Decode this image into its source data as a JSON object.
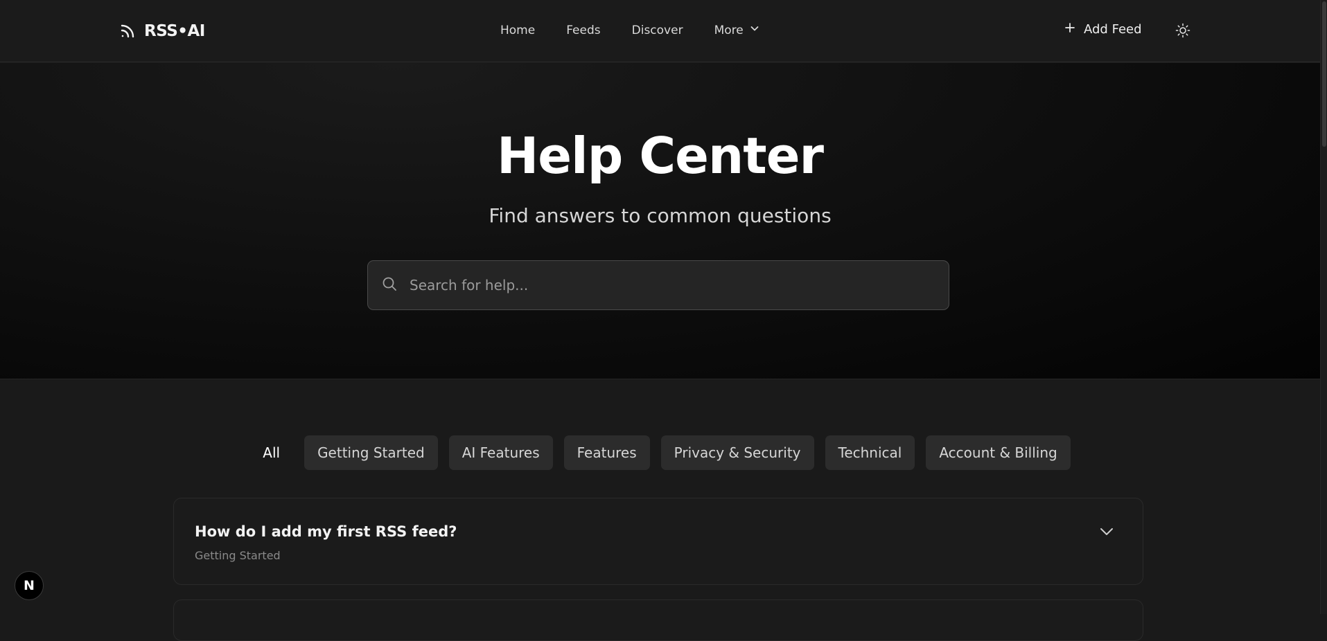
{
  "header": {
    "brand": "RSS•AI",
    "nav": [
      {
        "label": "Home"
      },
      {
        "label": "Feeds"
      },
      {
        "label": "Discover"
      },
      {
        "label": "More"
      }
    ],
    "add_feed_label": "Add Feed"
  },
  "hero": {
    "title": "Help Center",
    "subtitle": "Find answers to common questions",
    "search_placeholder": "Search for help..."
  },
  "filters": [
    {
      "label": "All",
      "active": true
    },
    {
      "label": "Getting Started"
    },
    {
      "label": "AI Features"
    },
    {
      "label": "Features"
    },
    {
      "label": "Privacy & Security"
    },
    {
      "label": "Technical"
    },
    {
      "label": "Account & Billing"
    }
  ],
  "faq": [
    {
      "question": "How do I add my first RSS feed?",
      "category": "Getting Started"
    }
  ],
  "dev_badge": "N"
}
